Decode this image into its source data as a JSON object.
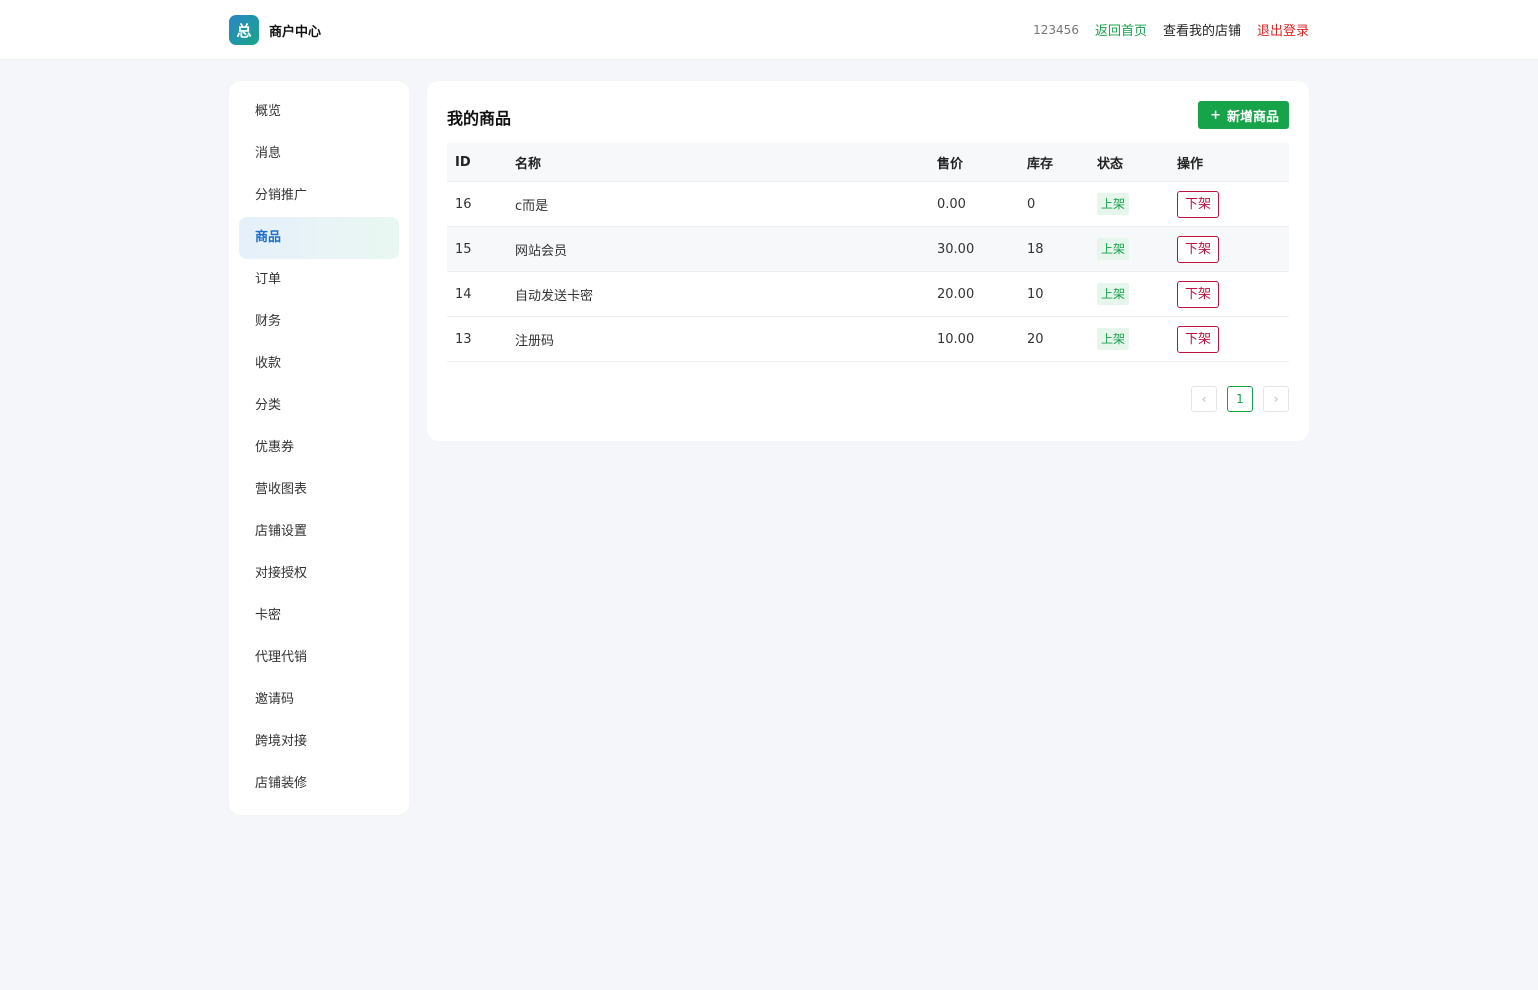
{
  "header": {
    "logo_glyph": "总",
    "title": "商户中心",
    "user_id": "123456",
    "home_link": "返回首页",
    "shop_link": "查看我的店铺",
    "logout_link": "退出登录"
  },
  "sidebar": {
    "active_index": 3,
    "items": [
      {
        "label": "概览"
      },
      {
        "label": "消息"
      },
      {
        "label": "分销推广"
      },
      {
        "label": "商品"
      },
      {
        "label": "订单"
      },
      {
        "label": "财务"
      },
      {
        "label": "收款"
      },
      {
        "label": "分类"
      },
      {
        "label": "优惠券"
      },
      {
        "label": "营收图表"
      },
      {
        "label": "店铺设置"
      },
      {
        "label": "对接授权"
      },
      {
        "label": "卡密"
      },
      {
        "label": "代理代销"
      },
      {
        "label": "邀请码"
      },
      {
        "label": "跨境对接"
      },
      {
        "label": "店铺装修"
      }
    ]
  },
  "main": {
    "title": "我的商品",
    "add_button": {
      "icon": "+",
      "label": "新增商品"
    },
    "table": {
      "columns": [
        "ID",
        "名称",
        "售价",
        "库存",
        "状态",
        "操作"
      ],
      "rows": [
        {
          "id": "16",
          "name": "c而是",
          "price": "0.00",
          "stock": "0",
          "status": "上架",
          "action": "下架"
        },
        {
          "id": "15",
          "name": "网站会员",
          "price": "30.00",
          "stock": "18",
          "status": "上架",
          "action": "下架"
        },
        {
          "id": "14",
          "name": "自动发送卡密",
          "price": "20.00",
          "stock": "10",
          "status": "上架",
          "action": "下架"
        },
        {
          "id": "13",
          "name": "注册码",
          "price": "10.00",
          "stock": "20",
          "status": "上架",
          "action": "下架"
        }
      ]
    },
    "pagination": {
      "prev": "‹",
      "current_page": "1",
      "next": "›"
    }
  },
  "colors": {
    "accent": "#16a34a",
    "danger": "#be123c",
    "active_nav": "#1d6fd1"
  }
}
